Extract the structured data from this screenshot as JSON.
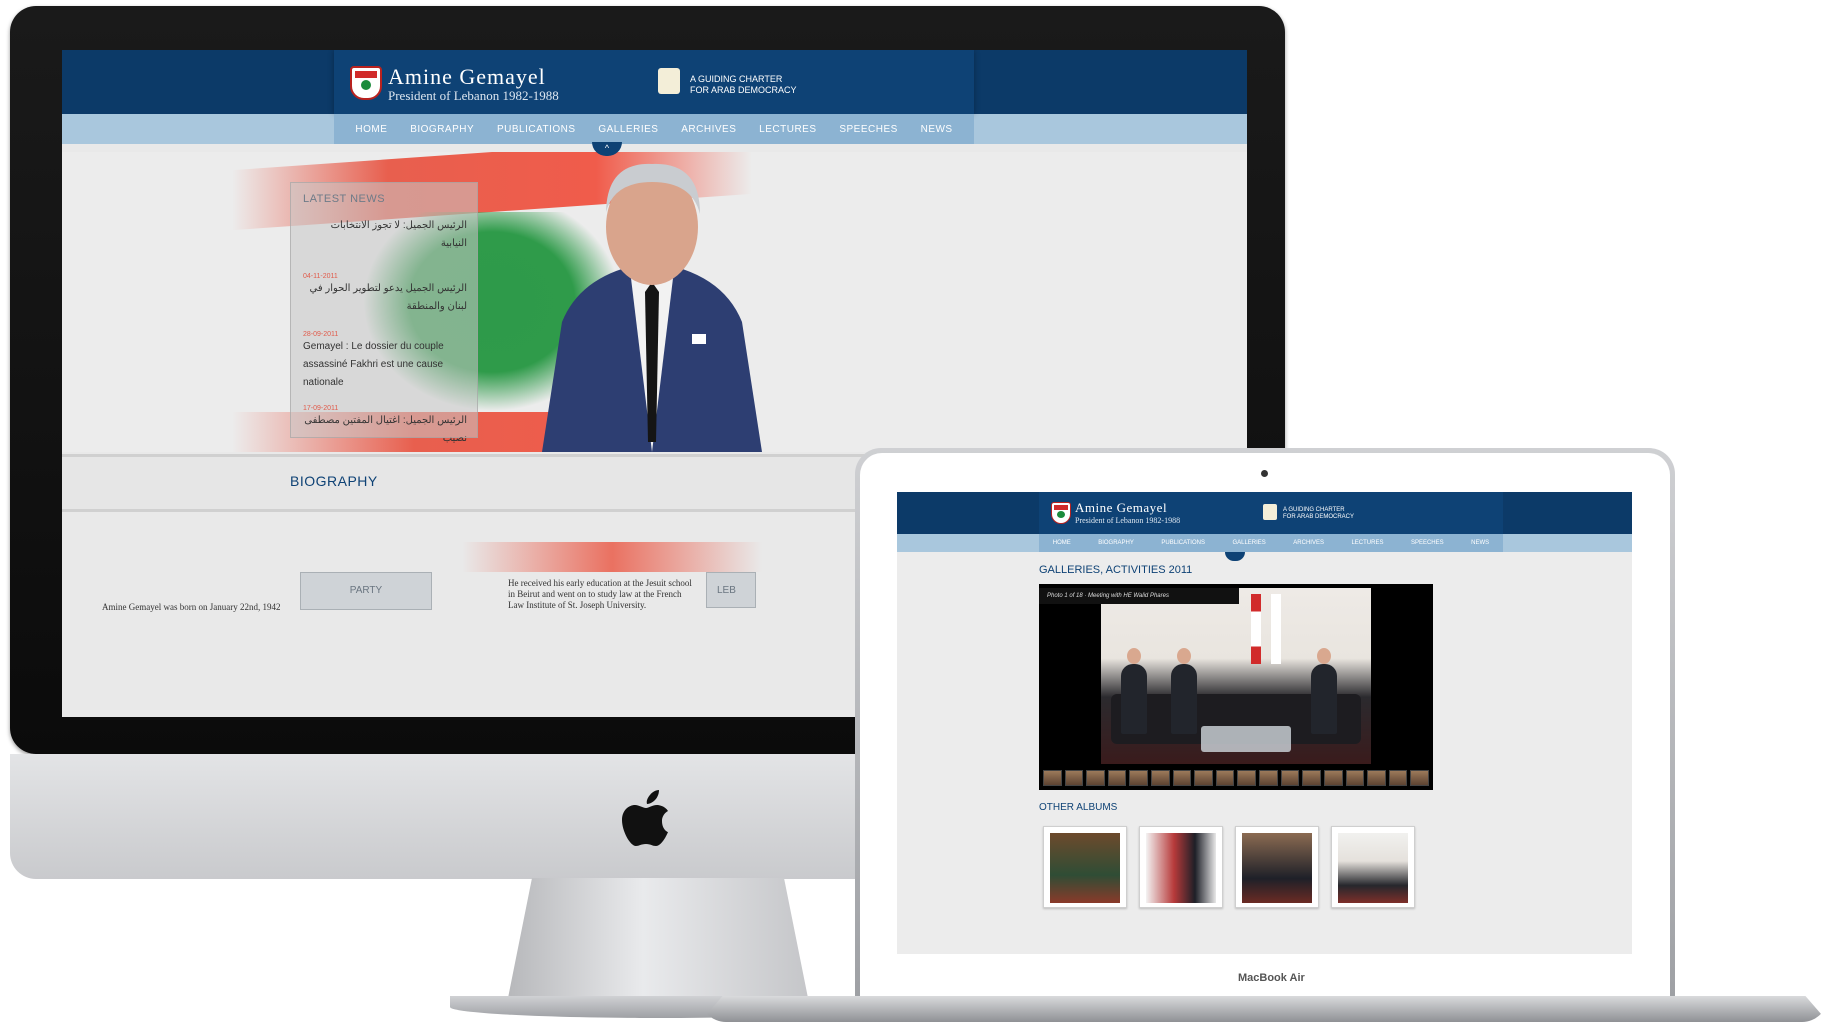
{
  "imac": {
    "brand": {
      "name": "Amine Gemayel",
      "subtitle": "President of Lebanon 1982-1988"
    },
    "charter": {
      "line1": "A GUIDING CHARTER",
      "line2": "FOR ARAB DEMOCRACY"
    },
    "nav": [
      "HOME",
      "BIOGRAPHY",
      "PUBLICATIONS",
      "GALLERIES",
      "ARCHIVES",
      "LECTURES",
      "SPEECHES",
      "NEWS"
    ],
    "nav_tab_arrow": "^",
    "latest_news": {
      "title": "LATEST NEWS",
      "items": [
        {
          "date": "",
          "text": "الرئيس الجميل: لا تجوز الانتخابات النيابية"
        },
        {
          "date": "04-11-2011",
          "text": "الرئيس الجميل يدعو لتطوير الحوار في لبنان والمنطقة"
        },
        {
          "date": "28-09-2011",
          "text": "Gemayel : Le dossier du couple assassiné Fakhri est une cause nationale"
        },
        {
          "date": "17-09-2011",
          "text": "الرئيس الجميل: اغتيال المفتين مصطفى نصيب"
        }
      ]
    },
    "biography_title": "BIOGRAPHY",
    "party_button": "PARTY",
    "leb_button": "LEB",
    "bio_text_1": "Amine Gemayel was born on January 22nd, 1942",
    "bio_text_2": "He received his early education at the Jesuit school in Beirut and went on to study law at the French Law Institute of St. Joseph University."
  },
  "macbook": {
    "label": "MacBook Air",
    "brand": {
      "name": "Amine Gemayel",
      "subtitle": "President of Lebanon 1982-1988"
    },
    "charter": {
      "line1": "A GUIDING CHARTER",
      "line2": "FOR ARAB DEMOCRACY"
    },
    "nav": [
      "HOME",
      "BIOGRAPHY",
      "PUBLICATIONS",
      "GALLERIES",
      "ARCHIVES",
      "LECTURES",
      "SPEECHES",
      "NEWS"
    ],
    "gallery_title": "GALLERIES, ACTIVITIES 2011",
    "gallery_caption": "Photo 1 of 18 · Meeting with HE Walid Phares",
    "other_albums_title": "OTHER ALBUMS"
  },
  "colors": {
    "navy": "#0e4275",
    "nav_light": "#8cb3d2",
    "lebanon_red": "#d12b2b",
    "cedar_green": "#1b8b3c"
  },
  "icons": [
    "apple-logo-icon",
    "lebanon-crest-icon",
    "charter-scroll-icon"
  ]
}
